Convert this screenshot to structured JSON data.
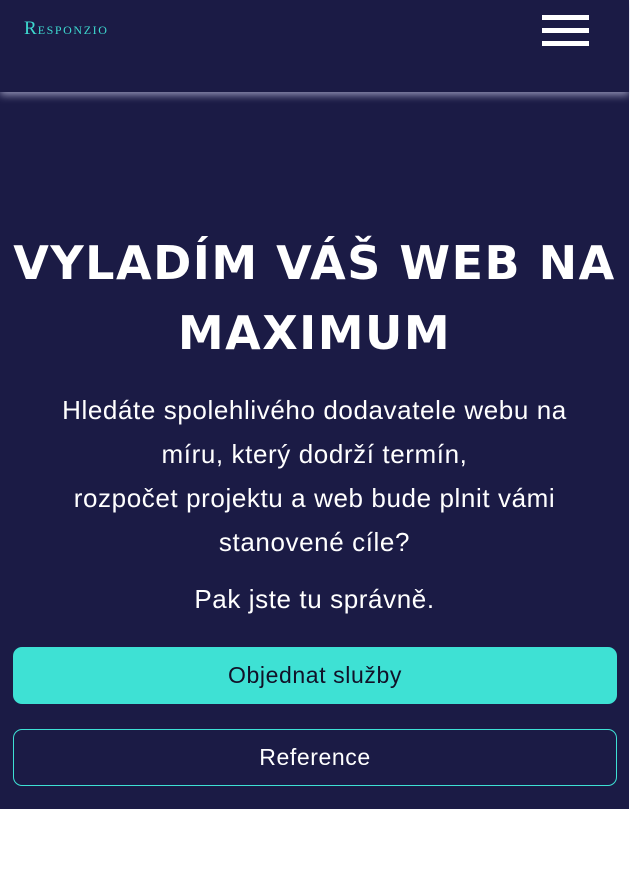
{
  "brand": {
    "logo_initial": "R",
    "logo_rest": "ESPONZIO",
    "accent_color": "#3dd8cf",
    "background_color": "#1b1b45"
  },
  "header": {
    "menu_icon": "hamburger-menu-icon"
  },
  "hero": {
    "headline_line1": "VYLADÍM VÁŠ WEB NA",
    "headline_line2": "MAXIMUM",
    "lead_line1": "Hledáte spolehlivého dodavatele webu na",
    "lead_line2": "míru, který dodrží termín,",
    "lead_line3": "rozpočet projektu a web bude plnit vámi",
    "lead_line4": "stanovené cíle?",
    "tagline": "Pak jste tu správně."
  },
  "actions": {
    "primary_label": "Objednat služby",
    "secondary_label": "Reference"
  }
}
